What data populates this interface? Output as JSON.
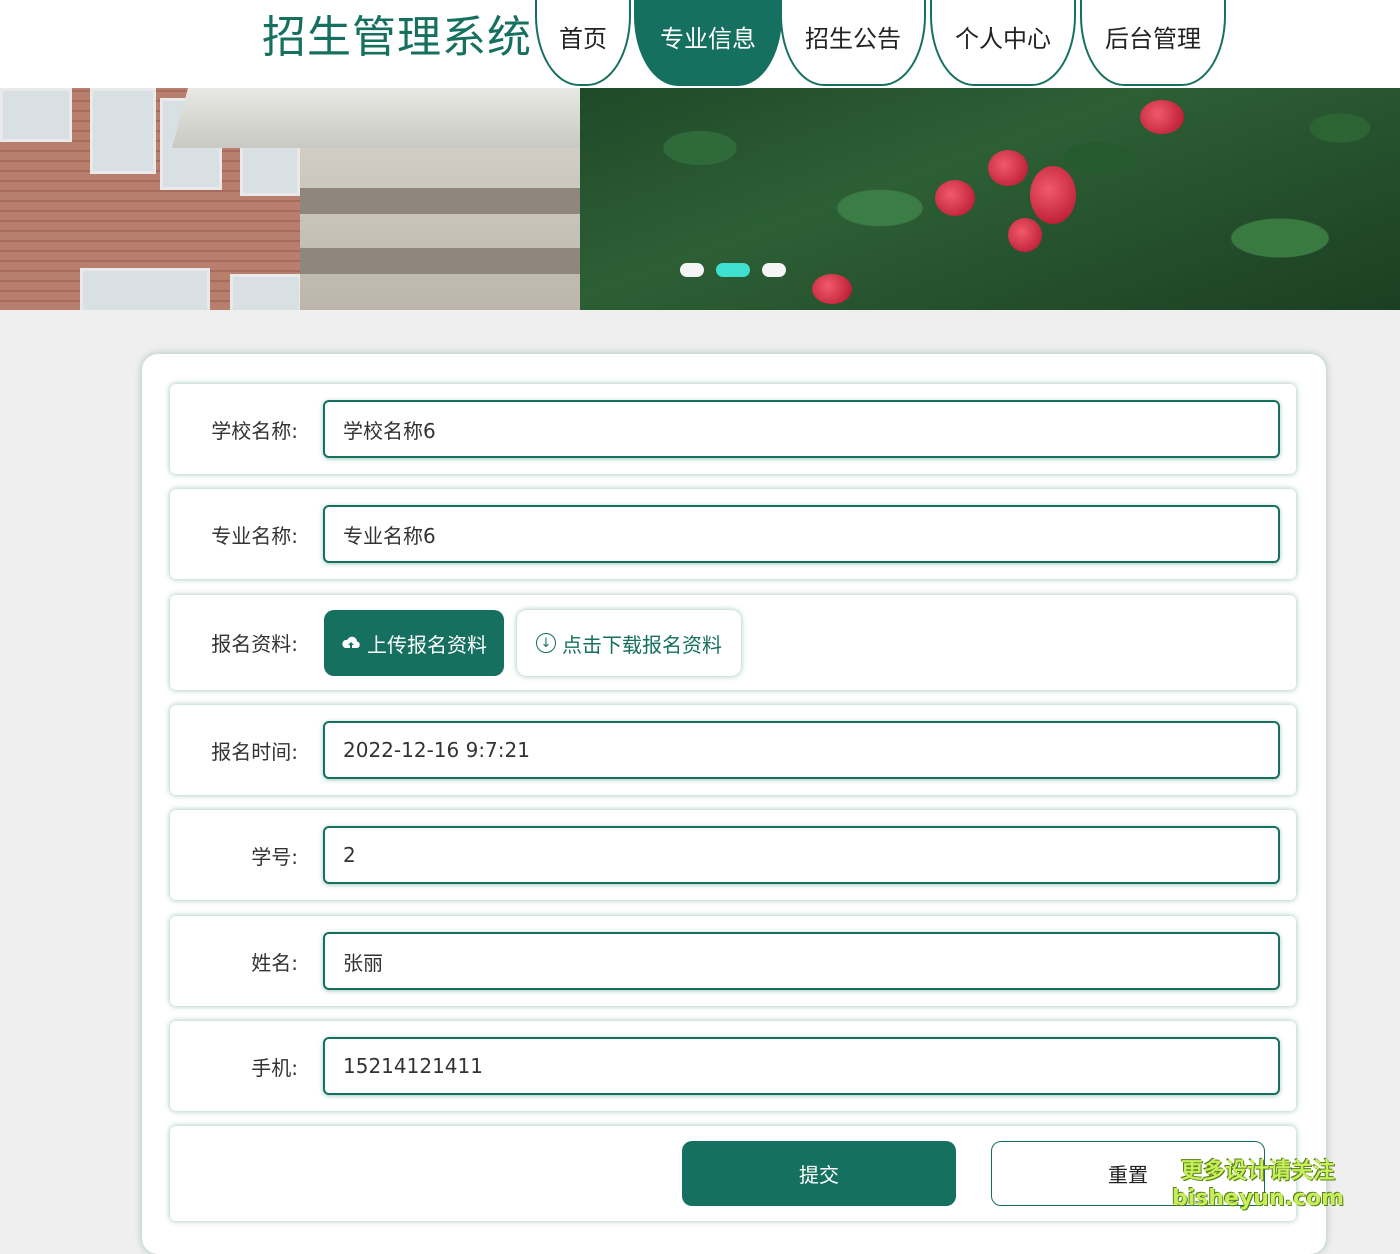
{
  "header": {
    "title": "招生管理系统",
    "nav": [
      {
        "label": "首页"
      },
      {
        "label": "专业信息",
        "active": true
      },
      {
        "label": "招生公告"
      },
      {
        "label": "个人中心"
      },
      {
        "label": "后台管理"
      }
    ]
  },
  "banner": {
    "slides": 3,
    "active_slide": 2
  },
  "form": {
    "school_name": {
      "label": "学校名称:",
      "value": "学校名称6"
    },
    "major_name": {
      "label": "专业名称:",
      "value": "专业名称6"
    },
    "materials": {
      "label": "报名资料:",
      "upload_label": "上传报名资料",
      "download_label": "点击下载报名资料"
    },
    "signup_time": {
      "label": "报名时间:",
      "value": "2022-12-16 9:7:21"
    },
    "student_id": {
      "label": "学号:",
      "value": "2"
    },
    "name": {
      "label": "姓名:",
      "value": "张丽"
    },
    "phone": {
      "label": "手机:",
      "value": "15214121411"
    },
    "submit_label": "提交",
    "reset_label": "重置"
  },
  "watermark": {
    "line1": "更多设计请关注",
    "line2": "bisheyun.com"
  },
  "colors": {
    "primary": "#16705f",
    "background": "#efefef",
    "dot_active": "#40e0d0"
  }
}
